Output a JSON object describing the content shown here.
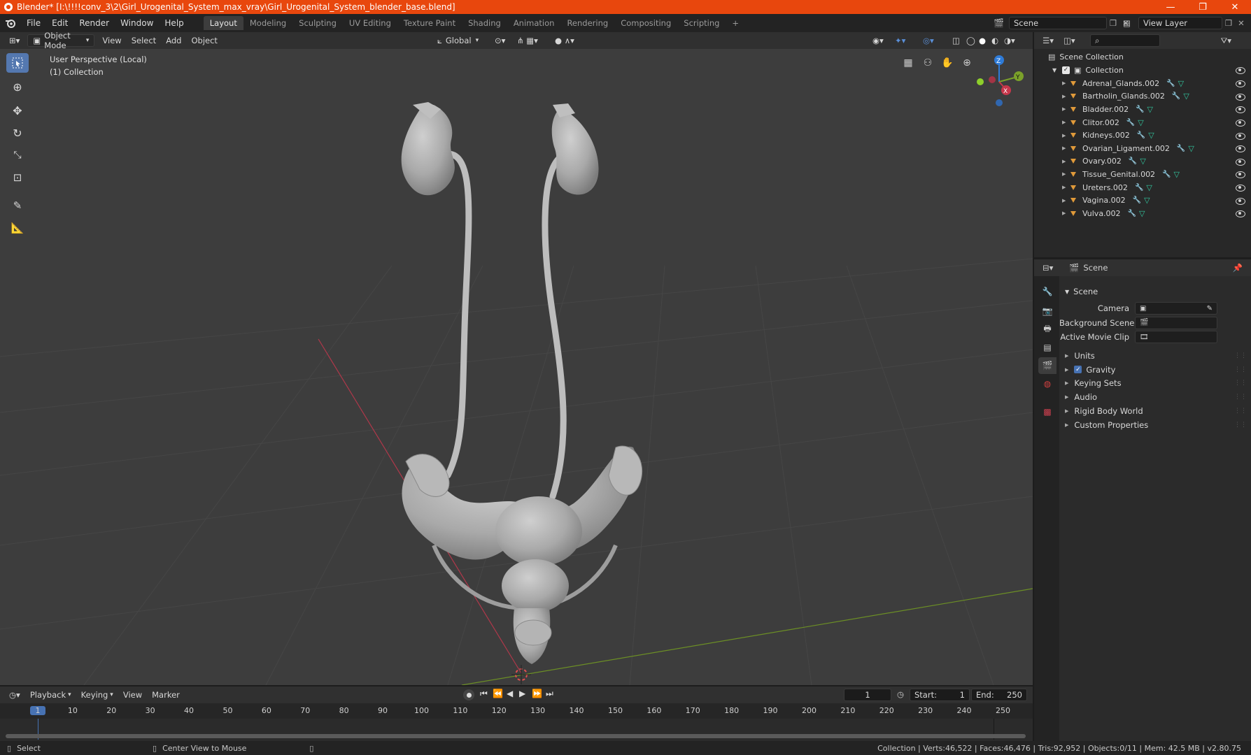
{
  "window": {
    "title": "Blender* [I:\\!!!!conv_3\\2\\Girl_Urogenital_System_max_vray\\Girl_Urogenital_System_blender_base.blend]",
    "controls": [
      "—",
      "❐",
      "✕"
    ]
  },
  "menu": [
    "File",
    "Edit",
    "Render",
    "Window",
    "Help"
  ],
  "workspaces": [
    "Layout",
    "Modeling",
    "Sculpting",
    "UV Editing",
    "Texture Paint",
    "Shading",
    "Animation",
    "Rendering",
    "Compositing",
    "Scripting"
  ],
  "workspace_add": "+",
  "scene_field": "Scene",
  "view_layer_field": "View Layer",
  "viewport_header": {
    "mode": "Object Mode",
    "menus": [
      "View",
      "Select",
      "Add",
      "Object"
    ],
    "orientation": "Global"
  },
  "viewport": {
    "perspective": "User Perspective (Local)",
    "collection": "(1) Collection",
    "gizmo": {
      "z": "Z",
      "x": "X",
      "y": "Y"
    }
  },
  "outliner": {
    "root": "Scene Collection",
    "collection": "Collection",
    "items": [
      "Adrenal_Glands.002",
      "Bartholin_Glands.002",
      "Bladder.002",
      "Clitor.002",
      "Kidneys.002",
      "Ovarian_Ligament.002",
      "Ovary.002",
      "Tissue_Genital.002",
      "Ureters.002",
      "Vagina.002",
      "Vulva.002"
    ]
  },
  "properties": {
    "context": "Scene",
    "panel": "Scene",
    "fields": [
      {
        "label": "Camera",
        "value": ""
      },
      {
        "label": "Background Scene",
        "value": ""
      },
      {
        "label": "Active Movie Clip",
        "value": ""
      }
    ],
    "sections": [
      "Units",
      "Gravity",
      "Keying Sets",
      "Audio",
      "Rigid Body World",
      "Custom Properties"
    ],
    "gravity_checked": true
  },
  "timeline": {
    "menus": [
      "Playback",
      "Keying",
      "View",
      "Marker"
    ],
    "current_frame": "1",
    "start_label": "Start:",
    "start": "1",
    "end_label": "End:",
    "end": "250",
    "ruler": [
      "1",
      "10",
      "20",
      "30",
      "40",
      "50",
      "60",
      "70",
      "80",
      "90",
      "100",
      "110",
      "120",
      "130",
      "140",
      "150",
      "160",
      "170",
      "180",
      "190",
      "200",
      "210",
      "220",
      "230",
      "240",
      "250"
    ],
    "current_marker": "1"
  },
  "status": {
    "left": "Select",
    "middle": "Center View to Mouse",
    "right": "Collection | Verts:46,522 | Faces:46,476 | Tris:92,952 | Objects:0/11 | Mem: 42.5 MB | v2.80.75"
  },
  "colors": {
    "accent": "#e8470d",
    "active_tool": "#5478b0",
    "timeline_frame": "#4772b3",
    "axis_x": "#c7374b",
    "axis_y": "#7ba12a",
    "axis_z": "#2e7bd8"
  }
}
